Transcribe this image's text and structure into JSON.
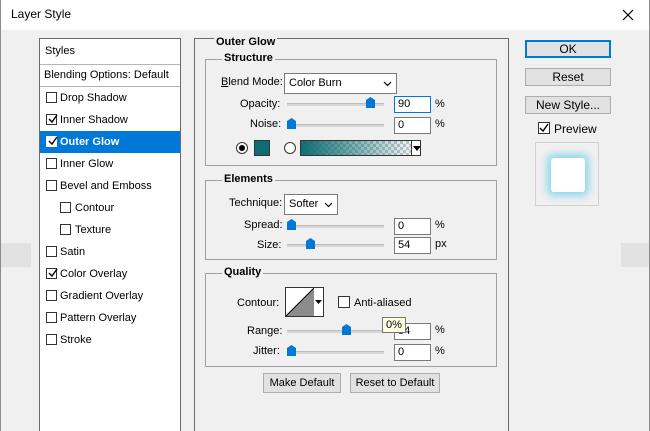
{
  "window": {
    "title": "Layer Style"
  },
  "styles_panel": {
    "header": "Styles",
    "blending_options": "Blending Options: Default",
    "items": [
      {
        "label": "Drop Shadow",
        "checked": false,
        "indent": false,
        "selected": false
      },
      {
        "label": "Inner Shadow",
        "checked": true,
        "indent": false,
        "selected": false
      },
      {
        "label": "Outer Glow",
        "checked": true,
        "indent": false,
        "selected": true
      },
      {
        "label": "Inner Glow",
        "checked": false,
        "indent": false,
        "selected": false
      },
      {
        "label": "Bevel and Emboss",
        "checked": false,
        "indent": false,
        "selected": false
      },
      {
        "label": "Contour",
        "checked": false,
        "indent": true,
        "selected": false
      },
      {
        "label": "Texture",
        "checked": false,
        "indent": true,
        "selected": false
      },
      {
        "label": "Satin",
        "checked": false,
        "indent": false,
        "selected": false
      },
      {
        "label": "Color Overlay",
        "checked": true,
        "indent": false,
        "selected": false
      },
      {
        "label": "Gradient Overlay",
        "checked": false,
        "indent": false,
        "selected": false
      },
      {
        "label": "Pattern Overlay",
        "checked": false,
        "indent": false,
        "selected": false
      },
      {
        "label": "Stroke",
        "checked": false,
        "indent": false,
        "selected": false
      }
    ]
  },
  "outer_glow": {
    "title": "Outer Glow",
    "structure": {
      "title": "Structure",
      "blend_mode_label": "Blend Mode:",
      "blend_mode_value": "Color Burn",
      "opacity_label": "Opacity:",
      "opacity_value": "90",
      "opacity_unit": "%",
      "opacity_level": 0.9,
      "noise_label": "Noise:",
      "noise_value": "0",
      "noise_unit": "%",
      "noise_level": 0.0,
      "glow_color": "#0e6d73"
    },
    "elements": {
      "title": "Elements",
      "technique_label": "Technique:",
      "technique_value": "Softer",
      "spread_label": "Spread:",
      "spread_value": "0",
      "spread_unit": "%",
      "spread_level": 0.0,
      "size_label": "Size:",
      "size_value": "54",
      "size_unit": "px",
      "size_level": 0.22
    },
    "quality": {
      "title": "Quality",
      "contour_label": "Contour:",
      "anti_aliased_label": "Anti-aliased",
      "anti_aliased_checked": false,
      "range_label": "Range:",
      "range_value": "54",
      "range_unit": "%",
      "range_level": 0.62,
      "range_tooltip": "0%",
      "jitter_label": "Jitter:",
      "jitter_value": "0",
      "jitter_unit": "%",
      "jitter_level": 0.0
    },
    "make_default": "Make Default",
    "reset_to_default": "Reset to Default"
  },
  "buttons": {
    "ok": "OK",
    "reset": "Reset",
    "new_style": "New Style...",
    "preview_label": "Preview",
    "preview_checked": true
  }
}
